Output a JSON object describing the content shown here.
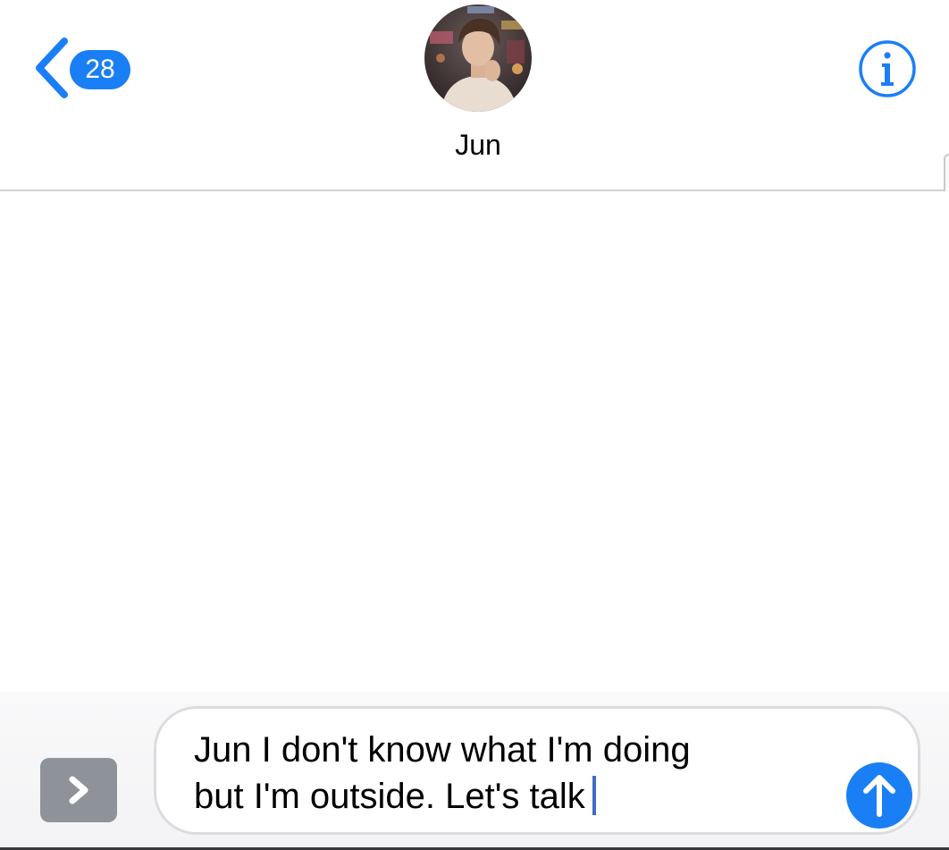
{
  "header": {
    "back_badge_count": "28",
    "contact_name": "Jun",
    "back_icon": "chevron-left-icon",
    "info_icon": "info-icon"
  },
  "compose": {
    "message_text": "Jun I don't know what I'm doing\nbut I'm outside. Let's talk",
    "expand_icon": "chevron-right-icon",
    "send_icon": "arrow-up-icon"
  },
  "colors": {
    "accent": "#1a7ff5",
    "expand_button": "#8e9299",
    "cursor": "#3f6cc4"
  }
}
